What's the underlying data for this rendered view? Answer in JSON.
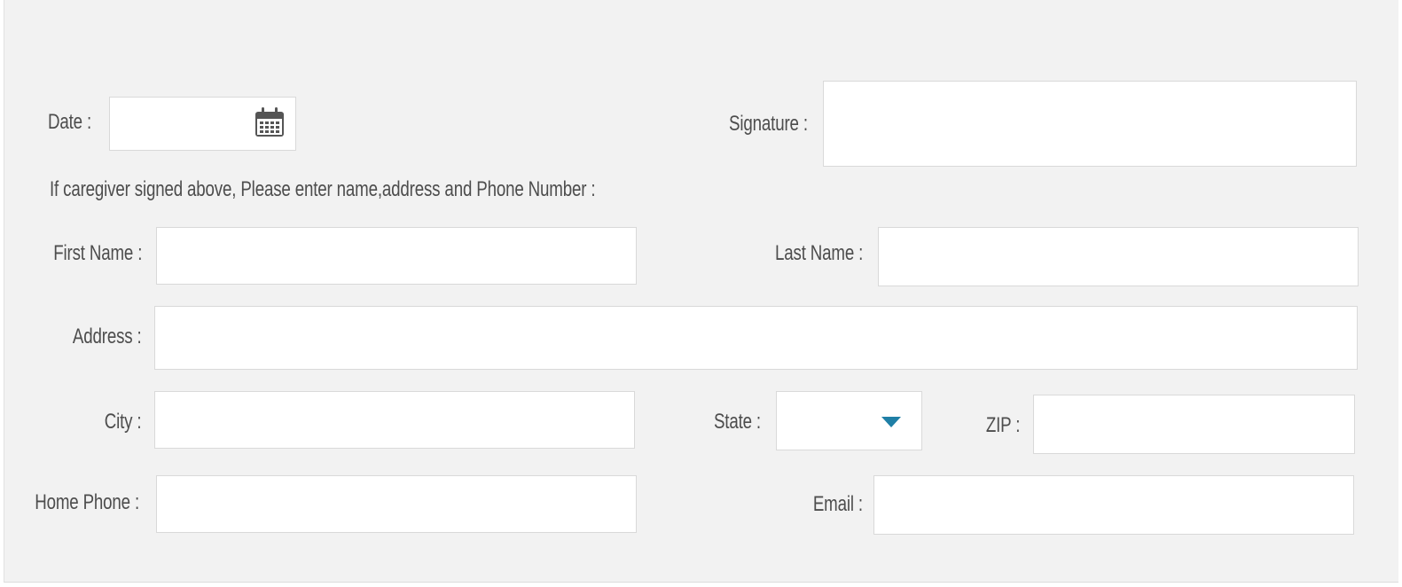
{
  "date": {
    "label": "Date :",
    "value": "",
    "icon": "calendar-icon"
  },
  "signature": {
    "label": "Signature :",
    "value": ""
  },
  "caregiver_note": "If caregiver signed above, Please enter name,address and Phone Number :",
  "first_name": {
    "label": "First Name :",
    "value": ""
  },
  "last_name": {
    "label": "Last Name :",
    "value": ""
  },
  "address": {
    "label": "Address :",
    "value": ""
  },
  "city": {
    "label": "City :",
    "value": ""
  },
  "state": {
    "label": "State  :",
    "value": "",
    "icon": "caret-down-icon",
    "accent": "#1f7fa6"
  },
  "zip": {
    "label": "ZIP  :",
    "value": ""
  },
  "home_phone": {
    "label": "Home Phone :",
    "value": ""
  },
  "email": {
    "label": "Email   :",
    "value": ""
  }
}
